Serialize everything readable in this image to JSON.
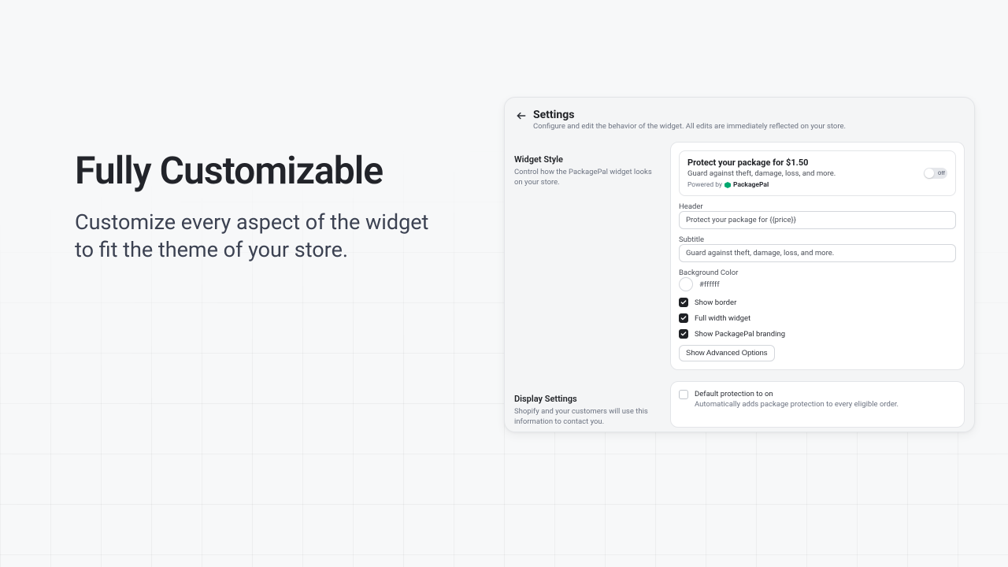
{
  "hero": {
    "title": "Fully Customizable",
    "subtitle": "Customize every aspect of the widget to fit the theme of your store."
  },
  "settings": {
    "title": "Settings",
    "subtitle": "Configure and edit the behavior of the widget. All edits are immediately reflected on your store."
  },
  "widget_style": {
    "title": "Widget Style",
    "description": "Control how the PackagePal widget looks on your store."
  },
  "preview": {
    "title": "Protect your package for $1.50",
    "subtitle": "Guard against theft, damage, loss, and more.",
    "powered_by_prefix": "Powered by",
    "brand_name": "PackagePal",
    "toggle_state": "Off"
  },
  "fields": {
    "header_label": "Header",
    "header_value": "Protect your package for {{price}}",
    "subtitle_label": "Subtitle",
    "subtitle_value": "Guard against theft, damage, loss, and more.",
    "bg_label": "Background Color",
    "bg_value": "#ffffff"
  },
  "checks": {
    "show_border": "Show border",
    "full_width": "Full width widget",
    "show_branding": "Show PackagePal branding"
  },
  "advanced_button": "Show Advanced Options",
  "display_settings": {
    "title": "Display Settings",
    "description": "Shopify and your customers will use this information to contact you.",
    "option_title": "Default protection to on",
    "option_sub": "Automatically adds package protection to every eligible order."
  }
}
